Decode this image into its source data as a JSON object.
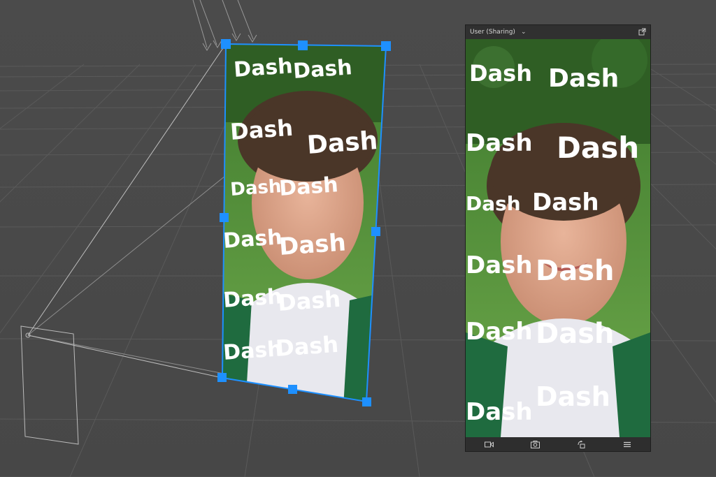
{
  "preview": {
    "device_label": "User (Sharing)",
    "chevron_icon": "chevron-down-icon",
    "popout_icon": "popout-icon"
  },
  "toolbar": {
    "icons": [
      "video-camera-icon",
      "flip-camera-icon",
      "rotate-icon",
      "menu-icon"
    ]
  },
  "effect": {
    "word": "Dash"
  },
  "colors": {
    "selection": "#1e90ff",
    "background": "#4a4a4a",
    "grid": "#5c5c5c"
  }
}
